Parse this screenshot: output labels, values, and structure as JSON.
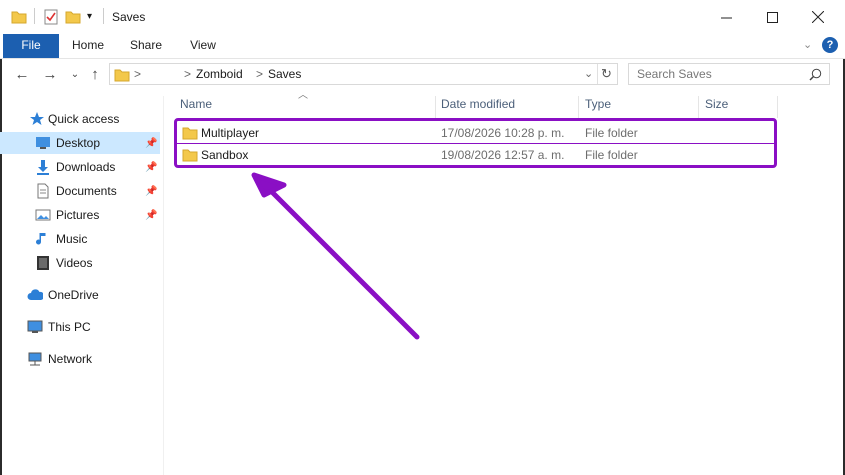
{
  "window": {
    "title": "Saves",
    "minimize_icon": "minimize-icon",
    "maximize_icon": "maximize-icon",
    "close_icon": "close-icon"
  },
  "ribbon": {
    "tabs": [
      {
        "label": "File"
      },
      {
        "label": "Home"
      },
      {
        "label": "Share"
      },
      {
        "label": "View"
      }
    ]
  },
  "address": {
    "chevron": ">",
    "path": [
      "Zomboid",
      "Saves"
    ]
  },
  "search": {
    "placeholder": "Search Saves"
  },
  "sidebar": {
    "quick_access": "Quick access",
    "items": [
      {
        "label": "Desktop",
        "pinned": true
      },
      {
        "label": "Downloads",
        "pinned": true
      },
      {
        "label": "Documents",
        "pinned": true
      },
      {
        "label": "Pictures",
        "pinned": true
      },
      {
        "label": "Music",
        "pinned": false
      },
      {
        "label": "Videos",
        "pinned": false
      }
    ],
    "onedrive": "OneDrive",
    "this_pc": "This PC",
    "network": "Network"
  },
  "columns": {
    "name": "Name",
    "date": "Date modified",
    "type": "Type",
    "size": "Size"
  },
  "files": [
    {
      "name": "Multiplayer",
      "date": "17/08/2026 10:28 p. m.",
      "type": "File folder"
    },
    {
      "name": "Sandbox",
      "date": "19/08/2026 12:57 a. m.",
      "type": "File folder"
    }
  ],
  "colors": {
    "accent": "#1c5fb0",
    "highlight": "#8a0fc4",
    "folder": "#f3c84b",
    "selected_nav": "#cce8ff"
  }
}
